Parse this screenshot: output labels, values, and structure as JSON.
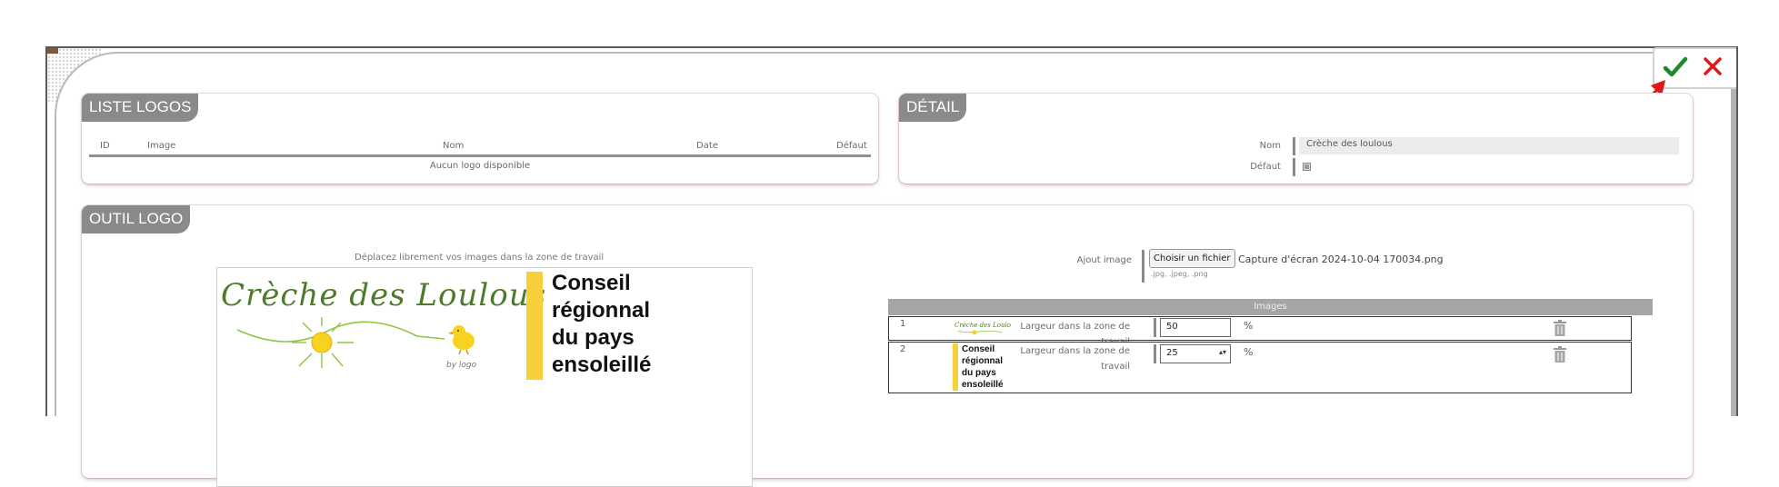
{
  "actions": {
    "validate_icon": "check-icon",
    "cancel_icon": "close-icon",
    "validate_color": "#1e8a2e",
    "cancel_color": "#e01818"
  },
  "liste": {
    "title": "LISTE LOGOS",
    "columns": [
      "ID",
      "Image",
      "Nom",
      "Date",
      "Défaut"
    ],
    "empty_message": "Aucun logo disponible"
  },
  "detail": {
    "title": "DÉTAIL",
    "nom_label": "Nom",
    "nom_value": "Crèche des loulous",
    "defaut_label": "Défaut"
  },
  "outil": {
    "title": "OUTIL LOGO",
    "hint": "Déplacez librement vos images dans la zone de travail",
    "logo1_text": "Crèche des Loulous",
    "logo1_by": "by logo",
    "logo2_lines": [
      "Conseil",
      "régionnal",
      "du pays",
      "ensoleillé"
    ],
    "ajout_label": "Ajout image",
    "file_button": "Choisir un fichier",
    "file_name": "Capture d'écran 2024-10-04 170034.png",
    "extensions": ".jpg, .jpeg, .png",
    "images_header": "Images",
    "rows": [
      {
        "index": "1",
        "label": "Largeur dans la zone de travail",
        "value": "50",
        "unit": "%"
      },
      {
        "index": "2",
        "label": "Largeur dans la zone de travail",
        "value": "25",
        "unit": "%"
      }
    ]
  },
  "colors": {
    "panel_title_bg": "#8a8a8a",
    "yellow_bar": "#f7cf38",
    "logo_green": "#4e7a2a",
    "arrow_red": "#e01818"
  }
}
